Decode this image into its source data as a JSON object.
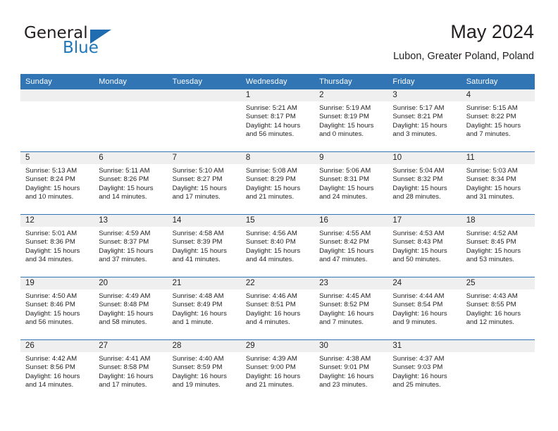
{
  "logo": {
    "word1": "General",
    "word2": "Blue",
    "triangle_color": "#1f6cb0",
    "blue_color": "#2077b8"
  },
  "header": {
    "title": "May 2024",
    "subtitle": "Lubon, Greater Poland, Poland"
  },
  "theme": {
    "header_blue": "#3175b4",
    "daynum_band": "#efeff0",
    "text": "#231f20"
  },
  "weekday_headers": [
    "Sunday",
    "Monday",
    "Tuesday",
    "Wednesday",
    "Thursday",
    "Friday",
    "Saturday"
  ],
  "labels": {
    "sunrise": "Sunrise:",
    "sunset": "Sunset:",
    "daylight": "Daylight:"
  },
  "weeks": [
    [
      {
        "day": "",
        "empty": true
      },
      {
        "day": "",
        "empty": true
      },
      {
        "day": "",
        "empty": true
      },
      {
        "day": "1",
        "sunrise": "Sunrise: 5:21 AM",
        "sunset": "Sunset: 8:17 PM",
        "daylight1": "Daylight: 14 hours",
        "daylight2": "and 56 minutes."
      },
      {
        "day": "2",
        "sunrise": "Sunrise: 5:19 AM",
        "sunset": "Sunset: 8:19 PM",
        "daylight1": "Daylight: 15 hours",
        "daylight2": "and 0 minutes."
      },
      {
        "day": "3",
        "sunrise": "Sunrise: 5:17 AM",
        "sunset": "Sunset: 8:21 PM",
        "daylight1": "Daylight: 15 hours",
        "daylight2": "and 3 minutes."
      },
      {
        "day": "4",
        "sunrise": "Sunrise: 5:15 AM",
        "sunset": "Sunset: 8:22 PM",
        "daylight1": "Daylight: 15 hours",
        "daylight2": "and 7 minutes."
      }
    ],
    [
      {
        "day": "5",
        "sunrise": "Sunrise: 5:13 AM",
        "sunset": "Sunset: 8:24 PM",
        "daylight1": "Daylight: 15 hours",
        "daylight2": "and 10 minutes."
      },
      {
        "day": "6",
        "sunrise": "Sunrise: 5:11 AM",
        "sunset": "Sunset: 8:26 PM",
        "daylight1": "Daylight: 15 hours",
        "daylight2": "and 14 minutes."
      },
      {
        "day": "7",
        "sunrise": "Sunrise: 5:10 AM",
        "sunset": "Sunset: 8:27 PM",
        "daylight1": "Daylight: 15 hours",
        "daylight2": "and 17 minutes."
      },
      {
        "day": "8",
        "sunrise": "Sunrise: 5:08 AM",
        "sunset": "Sunset: 8:29 PM",
        "daylight1": "Daylight: 15 hours",
        "daylight2": "and 21 minutes."
      },
      {
        "day": "9",
        "sunrise": "Sunrise: 5:06 AM",
        "sunset": "Sunset: 8:31 PM",
        "daylight1": "Daylight: 15 hours",
        "daylight2": "and 24 minutes."
      },
      {
        "day": "10",
        "sunrise": "Sunrise: 5:04 AM",
        "sunset": "Sunset: 8:32 PM",
        "daylight1": "Daylight: 15 hours",
        "daylight2": "and 28 minutes."
      },
      {
        "day": "11",
        "sunrise": "Sunrise: 5:03 AM",
        "sunset": "Sunset: 8:34 PM",
        "daylight1": "Daylight: 15 hours",
        "daylight2": "and 31 minutes."
      }
    ],
    [
      {
        "day": "12",
        "sunrise": "Sunrise: 5:01 AM",
        "sunset": "Sunset: 8:36 PM",
        "daylight1": "Daylight: 15 hours",
        "daylight2": "and 34 minutes."
      },
      {
        "day": "13",
        "sunrise": "Sunrise: 4:59 AM",
        "sunset": "Sunset: 8:37 PM",
        "daylight1": "Daylight: 15 hours",
        "daylight2": "and 37 minutes."
      },
      {
        "day": "14",
        "sunrise": "Sunrise: 4:58 AM",
        "sunset": "Sunset: 8:39 PM",
        "daylight1": "Daylight: 15 hours",
        "daylight2": "and 41 minutes."
      },
      {
        "day": "15",
        "sunrise": "Sunrise: 4:56 AM",
        "sunset": "Sunset: 8:40 PM",
        "daylight1": "Daylight: 15 hours",
        "daylight2": "and 44 minutes."
      },
      {
        "day": "16",
        "sunrise": "Sunrise: 4:55 AM",
        "sunset": "Sunset: 8:42 PM",
        "daylight1": "Daylight: 15 hours",
        "daylight2": "and 47 minutes."
      },
      {
        "day": "17",
        "sunrise": "Sunrise: 4:53 AM",
        "sunset": "Sunset: 8:43 PM",
        "daylight1": "Daylight: 15 hours",
        "daylight2": "and 50 minutes."
      },
      {
        "day": "18",
        "sunrise": "Sunrise: 4:52 AM",
        "sunset": "Sunset: 8:45 PM",
        "daylight1": "Daylight: 15 hours",
        "daylight2": "and 53 minutes."
      }
    ],
    [
      {
        "day": "19",
        "sunrise": "Sunrise: 4:50 AM",
        "sunset": "Sunset: 8:46 PM",
        "daylight1": "Daylight: 15 hours",
        "daylight2": "and 56 minutes."
      },
      {
        "day": "20",
        "sunrise": "Sunrise: 4:49 AM",
        "sunset": "Sunset: 8:48 PM",
        "daylight1": "Daylight: 15 hours",
        "daylight2": "and 58 minutes."
      },
      {
        "day": "21",
        "sunrise": "Sunrise: 4:48 AM",
        "sunset": "Sunset: 8:49 PM",
        "daylight1": "Daylight: 16 hours",
        "daylight2": "and 1 minute."
      },
      {
        "day": "22",
        "sunrise": "Sunrise: 4:46 AM",
        "sunset": "Sunset: 8:51 PM",
        "daylight1": "Daylight: 16 hours",
        "daylight2": "and 4 minutes."
      },
      {
        "day": "23",
        "sunrise": "Sunrise: 4:45 AM",
        "sunset": "Sunset: 8:52 PM",
        "daylight1": "Daylight: 16 hours",
        "daylight2": "and 7 minutes."
      },
      {
        "day": "24",
        "sunrise": "Sunrise: 4:44 AM",
        "sunset": "Sunset: 8:54 PM",
        "daylight1": "Daylight: 16 hours",
        "daylight2": "and 9 minutes."
      },
      {
        "day": "25",
        "sunrise": "Sunrise: 4:43 AM",
        "sunset": "Sunset: 8:55 PM",
        "daylight1": "Daylight: 16 hours",
        "daylight2": "and 12 minutes."
      }
    ],
    [
      {
        "day": "26",
        "sunrise": "Sunrise: 4:42 AM",
        "sunset": "Sunset: 8:56 PM",
        "daylight1": "Daylight: 16 hours",
        "daylight2": "and 14 minutes."
      },
      {
        "day": "27",
        "sunrise": "Sunrise: 4:41 AM",
        "sunset": "Sunset: 8:58 PM",
        "daylight1": "Daylight: 16 hours",
        "daylight2": "and 17 minutes."
      },
      {
        "day": "28",
        "sunrise": "Sunrise: 4:40 AM",
        "sunset": "Sunset: 8:59 PM",
        "daylight1": "Daylight: 16 hours",
        "daylight2": "and 19 minutes."
      },
      {
        "day": "29",
        "sunrise": "Sunrise: 4:39 AM",
        "sunset": "Sunset: 9:00 PM",
        "daylight1": "Daylight: 16 hours",
        "daylight2": "and 21 minutes."
      },
      {
        "day": "30",
        "sunrise": "Sunrise: 4:38 AM",
        "sunset": "Sunset: 9:01 PM",
        "daylight1": "Daylight: 16 hours",
        "daylight2": "and 23 minutes."
      },
      {
        "day": "31",
        "sunrise": "Sunrise: 4:37 AM",
        "sunset": "Sunset: 9:03 PM",
        "daylight1": "Daylight: 16 hours",
        "daylight2": "and 25 minutes."
      },
      {
        "day": "",
        "empty": true
      }
    ]
  ]
}
